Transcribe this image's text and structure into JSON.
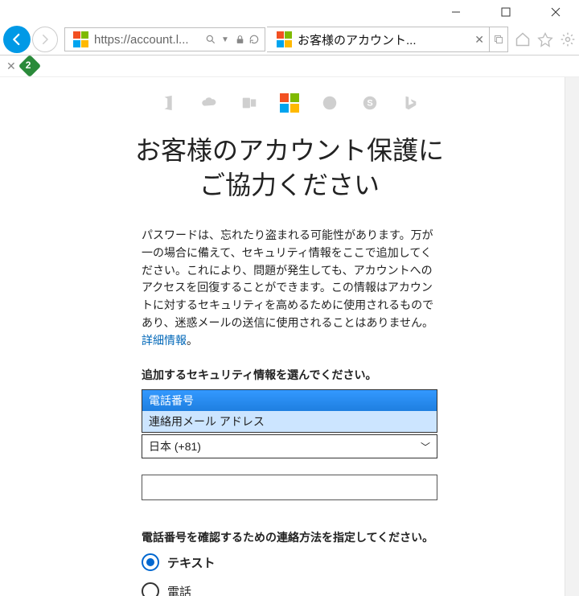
{
  "browser": {
    "url_text": "https://account.l...",
    "tab_title": "お客様のアカウント...",
    "ext_badge_count": "2"
  },
  "services": {
    "items": [
      "office",
      "onedrive",
      "outlook",
      "microsoft",
      "xbox",
      "skype",
      "bing"
    ]
  },
  "page": {
    "title_line1": "お客様のアカウント保護に",
    "title_line2": "ご協力ください",
    "body_text_pre": "パスワードは、忘れたり盗まれる可能性があります。万が一の場合に備えて、セキュリティ情報をここで追加してください。これにより、問題が発生しても、アカウントへのアクセスを回復することができます。この情報はアカウントに対するセキュリティを高めるために使用されるものであり、迷惑メールの送信に使用されることはありません。",
    "more_info": "詳細情報",
    "more_info_suffix": "。"
  },
  "form": {
    "choose_label": "追加するセキュリティ情報を選んでください。",
    "options": {
      "phone": "電話番号",
      "email": "連絡用メール アドレス"
    },
    "country_value": "日本 (+81)",
    "verify_label": "電話番号を確認するための連絡方法を指定してください。",
    "radio": {
      "text": "テキスト",
      "call": "電話"
    }
  }
}
